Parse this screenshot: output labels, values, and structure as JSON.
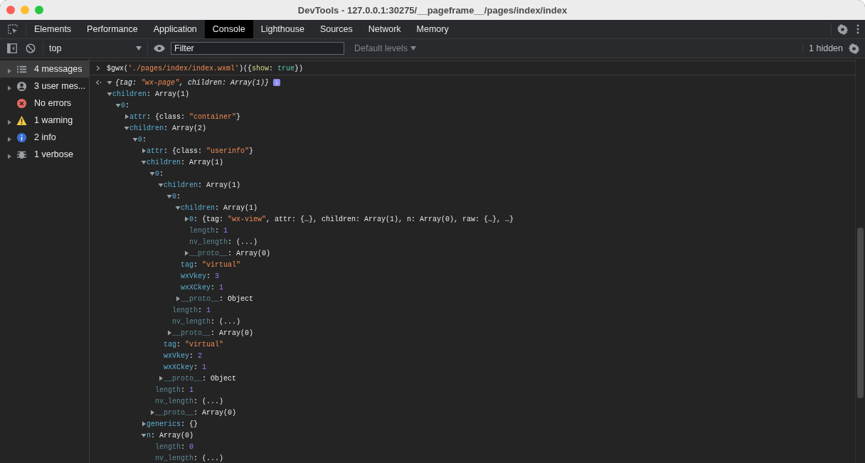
{
  "window": {
    "title": "DevTools - 127.0.0.1:30275/__pageframe__/pages/index/index"
  },
  "tabs": [
    {
      "label": "Elements",
      "selected": false
    },
    {
      "label": "Performance",
      "selected": false
    },
    {
      "label": "Application",
      "selected": false
    },
    {
      "label": "Console",
      "selected": true
    },
    {
      "label": "Lighthouse",
      "selected": false
    },
    {
      "label": "Sources",
      "selected": false
    },
    {
      "label": "Network",
      "selected": false
    },
    {
      "label": "Memory",
      "selected": false
    }
  ],
  "toolbar": {
    "context": "top",
    "filter": {
      "placeholder": "Filter"
    },
    "levels": {
      "label": "Default levels",
      "disabled": true
    },
    "hidden_count": "1 hidden"
  },
  "sidebar": {
    "items": [
      {
        "kind": "messages",
        "label": "4 messages",
        "expandable": true,
        "selected": true
      },
      {
        "kind": "user",
        "label": "3 user mes...",
        "expandable": true,
        "selected": false
      },
      {
        "kind": "error",
        "label": "No errors",
        "expandable": false,
        "selected": false
      },
      {
        "kind": "warning",
        "label": "1 warning",
        "expandable": true,
        "selected": false
      },
      {
        "kind": "info",
        "label": "2 info",
        "expandable": true,
        "selected": false
      },
      {
        "kind": "verbose",
        "label": "1 verbose",
        "expandable": true,
        "selected": false
      }
    ]
  },
  "console": {
    "entries": [
      {
        "kind": "input",
        "parts": [
          {
            "text": "$gwx(",
            "kind": "plain"
          },
          {
            "text": "'./pages/index/index.wxml'",
            "kind": "string"
          },
          {
            "text": ")({",
            "kind": "plain"
          },
          {
            "text": "show",
            "kind": "name"
          },
          {
            "text": ": ",
            "kind": "plain"
          },
          {
            "text": "true",
            "kind": "keyword"
          },
          {
            "text": "})",
            "kind": "plain"
          }
        ]
      },
      {
        "kind": "result",
        "info_badge": true,
        "node": {
          "expanded": true,
          "italic": true,
          "parts": [
            {
              "text": "{tag: ",
              "kind": "plain"
            },
            {
              "text": "\"wx-page\"",
              "kind": "string"
            },
            {
              "text": ", children: Array(1)}",
              "kind": "plain"
            }
          ],
          "children": [
            {
              "expanded": true,
              "parts": [
                {
                  "text": "children",
                  "kind": "key"
                },
                {
                  "text": ": Array(1)",
                  "kind": "plain"
                }
              ],
              "children": [
                {
                  "expanded": true,
                  "parts": [
                    {
                      "text": "0",
                      "kind": "key"
                    },
                    {
                      "text": ":",
                      "kind": "plain"
                    }
                  ],
                  "children": [
                    {
                      "expanded": false,
                      "parts": [
                        {
                          "text": "attr",
                          "kind": "key"
                        },
                        {
                          "text": ": {class: ",
                          "kind": "plain"
                        },
                        {
                          "text": "\"container\"",
                          "kind": "string"
                        },
                        {
                          "text": "}",
                          "kind": "plain"
                        }
                      ]
                    },
                    {
                      "expanded": true,
                      "parts": [
                        {
                          "text": "children",
                          "kind": "key"
                        },
                        {
                          "text": ": Array(2)",
                          "kind": "plain"
                        }
                      ],
                      "children": [
                        {
                          "expanded": true,
                          "parts": [
                            {
                              "text": "0",
                              "kind": "key"
                            },
                            {
                              "text": ":",
                              "kind": "plain"
                            }
                          ],
                          "children": [
                            {
                              "expanded": false,
                              "parts": [
                                {
                                  "text": "attr",
                                  "kind": "key"
                                },
                                {
                                  "text": ": {class: ",
                                  "kind": "plain"
                                },
                                {
                                  "text": "\"userinfo\"",
                                  "kind": "string"
                                },
                                {
                                  "text": "}",
                                  "kind": "plain"
                                }
                              ]
                            },
                            {
                              "expanded": true,
                              "parts": [
                                {
                                  "text": "children",
                                  "kind": "key"
                                },
                                {
                                  "text": ": Array(1)",
                                  "kind": "plain"
                                }
                              ],
                              "children": [
                                {
                                  "expanded": true,
                                  "parts": [
                                    {
                                      "text": "0",
                                      "kind": "key"
                                    },
                                    {
                                      "text": ":",
                                      "kind": "plain"
                                    }
                                  ],
                                  "children": [
                                    {
                                      "expanded": true,
                                      "parts": [
                                        {
                                          "text": "children",
                                          "kind": "key"
                                        },
                                        {
                                          "text": ": Array(1)",
                                          "kind": "plain"
                                        }
                                      ],
                                      "children": [
                                        {
                                          "expanded": true,
                                          "parts": [
                                            {
                                              "text": "0",
                                              "kind": "key"
                                            },
                                            {
                                              "text": ":",
                                              "kind": "plain"
                                            }
                                          ],
                                          "children": [
                                            {
                                              "expanded": true,
                                              "parts": [
                                                {
                                                  "text": "children",
                                                  "kind": "key"
                                                },
                                                {
                                                  "text": ": Array(1)",
                                                  "kind": "plain"
                                                }
                                              ],
                                              "children": [
                                                {
                                                  "expanded": false,
                                                  "parts": [
                                                    {
                                                      "text": "0",
                                                      "kind": "key"
                                                    },
                                                    {
                                                      "text": ": {tag: ",
                                                      "kind": "plain"
                                                    },
                                                    {
                                                      "text": "\"wx-view\"",
                                                      "kind": "string"
                                                    },
                                                    {
                                                      "text": ", attr: {…}, children: Array(1), n: Array(0), raw: {…}, …}",
                                                      "kind": "plain"
                                                    }
                                                  ]
                                                },
                                                {
                                                  "parts": [
                                                    {
                                                      "text": "length",
                                                      "kind": "dimkey"
                                                    },
                                                    {
                                                      "text": ": ",
                                                      "kind": "plain"
                                                    },
                                                    {
                                                      "text": "1",
                                                      "kind": "number"
                                                    }
                                                  ]
                                                },
                                                {
                                                  "parts": [
                                                    {
                                                      "text": "nv_length",
                                                      "kind": "dimkey"
                                                    },
                                                    {
                                                      "text": ": (...)",
                                                      "kind": "plain"
                                                    }
                                                  ]
                                                },
                                                {
                                                  "expanded": false,
                                                  "parts": [
                                                    {
                                                      "text": "__proto__",
                                                      "kind": "dimkey"
                                                    },
                                                    {
                                                      "text": ": Array(0)",
                                                      "kind": "plain"
                                                    }
                                                  ]
                                                }
                                              ]
                                            },
                                            {
                                              "parts": [
                                                {
                                                  "text": "tag",
                                                  "kind": "key"
                                                },
                                                {
                                                  "text": ": ",
                                                  "kind": "plain"
                                                },
                                                {
                                                  "text": "\"virtual\"",
                                                  "kind": "string"
                                                }
                                              ]
                                            },
                                            {
                                              "parts": [
                                                {
                                                  "text": "wxVkey",
                                                  "kind": "key"
                                                },
                                                {
                                                  "text": ": ",
                                                  "kind": "plain"
                                                },
                                                {
                                                  "text": "3",
                                                  "kind": "number"
                                                }
                                              ]
                                            },
                                            {
                                              "parts": [
                                                {
                                                  "text": "wxXCkey",
                                                  "kind": "key"
                                                },
                                                {
                                                  "text": ": ",
                                                  "kind": "plain"
                                                },
                                                {
                                                  "text": "1",
                                                  "kind": "number"
                                                }
                                              ]
                                            },
                                            {
                                              "expanded": false,
                                              "parts": [
                                                {
                                                  "text": "__proto__",
                                                  "kind": "dimkey"
                                                },
                                                {
                                                  "text": ": Object",
                                                  "kind": "plain"
                                                }
                                              ]
                                            }
                                          ]
                                        },
                                        {
                                          "parts": [
                                            {
                                              "text": "length",
                                              "kind": "dimkey"
                                            },
                                            {
                                              "text": ": ",
                                              "kind": "plain"
                                            },
                                            {
                                              "text": "1",
                                              "kind": "number"
                                            }
                                          ]
                                        },
                                        {
                                          "parts": [
                                            {
                                              "text": "nv_length",
                                              "kind": "dimkey"
                                            },
                                            {
                                              "text": ": (...)",
                                              "kind": "plain"
                                            }
                                          ]
                                        },
                                        {
                                          "expanded": false,
                                          "parts": [
                                            {
                                              "text": "__proto__",
                                              "kind": "dimkey"
                                            },
                                            {
                                              "text": ": Array(0)",
                                              "kind": "plain"
                                            }
                                          ]
                                        }
                                      ]
                                    },
                                    {
                                      "parts": [
                                        {
                                          "text": "tag",
                                          "kind": "key"
                                        },
                                        {
                                          "text": ": ",
                                          "kind": "plain"
                                        },
                                        {
                                          "text": "\"virtual\"",
                                          "kind": "string"
                                        }
                                      ]
                                    },
                                    {
                                      "parts": [
                                        {
                                          "text": "wxVkey",
                                          "kind": "key"
                                        },
                                        {
                                          "text": ": ",
                                          "kind": "plain"
                                        },
                                        {
                                          "text": "2",
                                          "kind": "number"
                                        }
                                      ]
                                    },
                                    {
                                      "parts": [
                                        {
                                          "text": "wxXCkey",
                                          "kind": "key"
                                        },
                                        {
                                          "text": ": ",
                                          "kind": "plain"
                                        },
                                        {
                                          "text": "1",
                                          "kind": "number"
                                        }
                                      ]
                                    },
                                    {
                                      "expanded": false,
                                      "parts": [
                                        {
                                          "text": "__proto__",
                                          "kind": "dimkey"
                                        },
                                        {
                                          "text": ": Object",
                                          "kind": "plain"
                                        }
                                      ]
                                    }
                                  ]
                                },
                                {
                                  "parts": [
                                    {
                                      "text": "length",
                                      "kind": "dimkey"
                                    },
                                    {
                                      "text": ": ",
                                      "kind": "plain"
                                    },
                                    {
                                      "text": "1",
                                      "kind": "number"
                                    }
                                  ]
                                },
                                {
                                  "parts": [
                                    {
                                      "text": "nv_length",
                                      "kind": "dimkey"
                                    },
                                    {
                                      "text": ": (...)",
                                      "kind": "plain"
                                    }
                                  ]
                                },
                                {
                                  "expanded": false,
                                  "parts": [
                                    {
                                      "text": "__proto__",
                                      "kind": "dimkey"
                                    },
                                    {
                                      "text": ": Array(0)",
                                      "kind": "plain"
                                    }
                                  ]
                                }
                              ]
                            },
                            {
                              "expanded": false,
                              "parts": [
                                {
                                  "text": "generics",
                                  "kind": "key"
                                },
                                {
                                  "text": ": {}",
                                  "kind": "plain"
                                }
                              ]
                            },
                            {
                              "expanded": true,
                              "parts": [
                                {
                                  "text": "n",
                                  "kind": "key"
                                },
                                {
                                  "text": ": Array(0)",
                                  "kind": "plain"
                                }
                              ],
                              "children": [
                                {
                                  "parts": [
                                    {
                                      "text": "length",
                                      "kind": "dimkey"
                                    },
                                    {
                                      "text": ": ",
                                      "kind": "plain"
                                    },
                                    {
                                      "text": "0",
                                      "kind": "number"
                                    }
                                  ]
                                },
                                {
                                  "parts": [
                                    {
                                      "text": "nv_length",
                                      "kind": "dimkey"
                                    },
                                    {
                                      "text": ": (...)",
                                      "kind": "plain"
                                    }
                                  ]
                                }
                              ]
                            }
                          ]
                        }
                      ]
                    }
                  ]
                }
              ]
            }
          ]
        }
      }
    ]
  }
}
